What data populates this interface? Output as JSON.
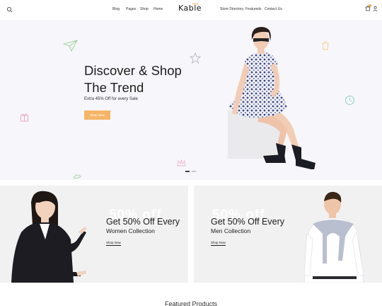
{
  "header": {
    "logo": "Kable",
    "nav_left": [
      "Blog",
      "Pages",
      "Shop",
      "Home"
    ],
    "nav_right": [
      "Store Directory",
      "Featureds",
      "Contact Us"
    ],
    "cart_count": ""
  },
  "hero": {
    "title_line1": "Discover & Shop",
    "title_line2": "The Trend",
    "subtitle": "Extra 45% Off for every Sale",
    "button_label": "Shop Now",
    "slide_count": 2,
    "active_slide": 1
  },
  "promos": [
    {
      "watermark": "50% off",
      "title": "Get 50% Off Every",
      "subtitle": "Women Collection",
      "link": "Shop Now"
    },
    {
      "watermark": "50% off",
      "title": "Get 50% Off Every",
      "subtitle": "Men Collection",
      "link": "Shop Now"
    }
  ],
  "section_heading": "Featured Products",
  "colors": {
    "accent": "#f5b567",
    "hero_bg": "#f7f6fb",
    "card_bg": "#f1f1f2"
  }
}
